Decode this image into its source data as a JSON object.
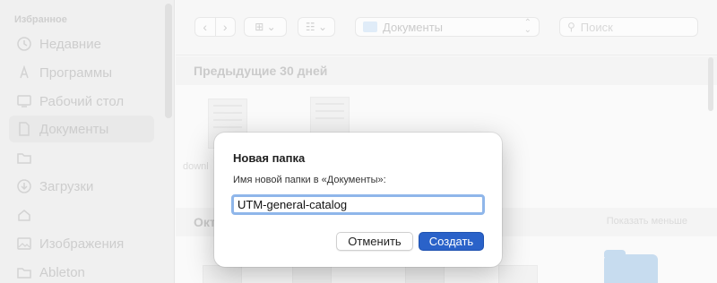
{
  "sidebar": {
    "heading": "Избранное",
    "items": [
      {
        "label": "Недавние",
        "icon": "clock-icon"
      },
      {
        "label": "Программы",
        "icon": "apps-icon"
      },
      {
        "label": "Рабочий стол",
        "icon": "desktop-icon"
      },
      {
        "label": "Документы",
        "icon": "document-icon",
        "selected": true
      },
      {
        "label": "",
        "icon": "folder-icon"
      },
      {
        "label": "Загрузки",
        "icon": "download-icon"
      },
      {
        "label": "",
        "icon": "home-icon"
      },
      {
        "label": "Изображения",
        "icon": "photo-icon"
      },
      {
        "label": "Ableton",
        "icon": "folder-icon"
      }
    ]
  },
  "toolbar": {
    "back_glyph": "‹",
    "forward_glyph": "›",
    "view_glyph": "⊞ ⌄",
    "group_glyph": "☷ ⌄",
    "path_label": "Документы",
    "search_placeholder": "Поиск"
  },
  "content": {
    "section1_title": "Предыдущие 30 дней",
    "file1_label": "downl",
    "section2_title": "Окт",
    "show_less": "Показать меньше"
  },
  "dialog": {
    "title": "Новая папка",
    "prompt": "Имя новой папки в «Документы»:",
    "input_value": "UTM-general-catalog",
    "cancel_label": "Отменить",
    "create_label": "Создать",
    "accent_color": "#2a62c9"
  }
}
